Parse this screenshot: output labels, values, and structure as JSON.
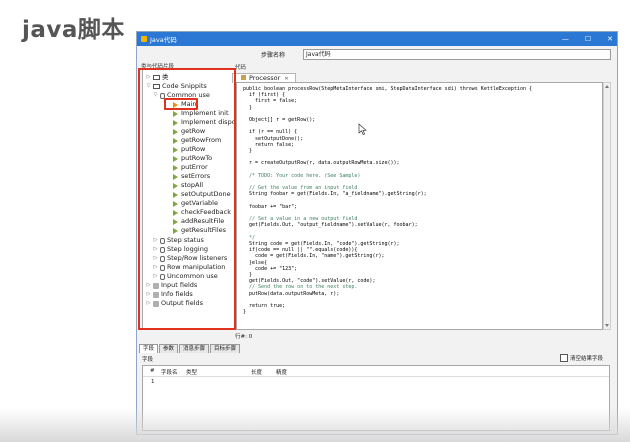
{
  "slide": {
    "title": "java脚本"
  },
  "window": {
    "title": "Java代码",
    "controls": {
      "minimize": "—",
      "maximize": "☐",
      "close": "✕"
    }
  },
  "step_name": {
    "label": "步骤名称",
    "value": "Java代码"
  },
  "panel_labels": {
    "snippets": "类与代码片段",
    "code": "代码"
  },
  "tree": {
    "classes": "类",
    "code_snippits": "Code Snippits",
    "common_use": "Common use",
    "items": [
      "Main",
      "Implement init",
      "Implement dispose",
      "getRow",
      "getRowFrom",
      "putRow",
      "putRowTo",
      "putError",
      "setErrors",
      "stopAll",
      "setOutputDone",
      "getVariable",
      "checkFeedback",
      "addResultFile",
      "getResultFiles"
    ],
    "groups": [
      "Step status",
      "Step logging",
      "Step/Row listeners",
      "Row manipulation",
      "Uncommon use"
    ],
    "fields": [
      "Input fields",
      "Info fields",
      "Output fields"
    ]
  },
  "editor": {
    "tab_label": "Processor",
    "lines": [
      "public boolean processRow(StepMetaInterface smi, StepDataInterface sdi) throws KettleException {",
      "  if (first) {",
      "    first = false;",
      "  }",
      "",
      "  Object[] r = getRow();",
      "",
      "  if (r == null) {",
      "    setOutputDone();",
      "    return false;",
      "  }",
      "",
      "  r = createOutputRow(r, data.outputRowMeta.size());",
      "",
      "  /* TODO: Your code here. (See Sample)",
      "",
      "  // Get the value from an input field",
      "  String foobar = get(Fields.In, \"a_fieldname\").getString(r);",
      "",
      "  foobar += \"bar\";",
      "",
      "  // Set a value in a new output field",
      "  get(Fields.Out, \"output_fieldname\").setValue(r, foobar);",
      "",
      "  */",
      "  String code = get(Fields.In, \"code\").getString(r);",
      "  if(code == null || \"\".equals(code)){",
      "    code = get(Fields.In, \"name\").getString(r);",
      "  }else{",
      "    code += \"123\";",
      "  }",
      "  get(Fields.Out, \"code\").setValue(r, code);",
      "  // Send the row on to the next step.",
      "  putRow(data.outputRowMeta, r);",
      "",
      "  return true;",
      "}"
    ],
    "position": "行#: 0"
  },
  "bottom_tabs": [
    "字段",
    "参数",
    "消息步骤",
    "目标步骤"
  ],
  "fields_section": {
    "label": "字段",
    "clear_checkbox": "清空结果字段",
    "columns": [
      "#",
      "字段名",
      "类型",
      "长度",
      "精度"
    ],
    "rows": [
      "1"
    ]
  }
}
